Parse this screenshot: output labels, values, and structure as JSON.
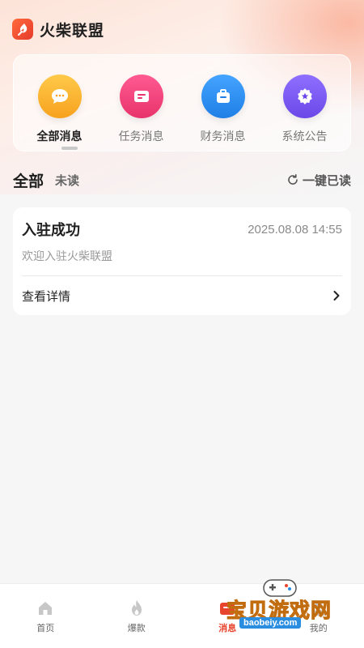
{
  "app": {
    "title": "火柴联盟"
  },
  "categories": [
    {
      "label": "全部消息",
      "icon": "chat-bubble-icon",
      "color": "#f9b233",
      "active": true
    },
    {
      "label": "任务消息",
      "icon": "message-lines-icon",
      "color": "#f0447e",
      "active": false
    },
    {
      "label": "财务消息",
      "icon": "briefcase-icon",
      "color": "#2f8ff3",
      "active": false
    },
    {
      "label": "系统公告",
      "icon": "star-badge-icon",
      "color": "#7b5cf0",
      "active": false
    }
  ],
  "filter": {
    "all_label": "全部",
    "unread_label": "未读",
    "mark_read_label": "一键已读"
  },
  "messages": [
    {
      "title": "入驻成功",
      "time": "2025.08.08 14:55",
      "body": "欢迎入驻火柴联盟",
      "detail_label": "查看详情"
    }
  ],
  "bottom_nav": [
    {
      "label": "首页",
      "icon": "home-icon",
      "active": false
    },
    {
      "label": "爆款",
      "icon": "flame-icon",
      "active": false
    },
    {
      "label": "消息",
      "icon": "message-icon",
      "active": true
    },
    {
      "label": "我的",
      "icon": "user-icon",
      "active": false
    }
  ],
  "watermark": {
    "text": "宝贝游戏网",
    "url": "baobeiy.com"
  },
  "colors": {
    "accent": "#e8452e",
    "background": "#f6f6f7"
  }
}
